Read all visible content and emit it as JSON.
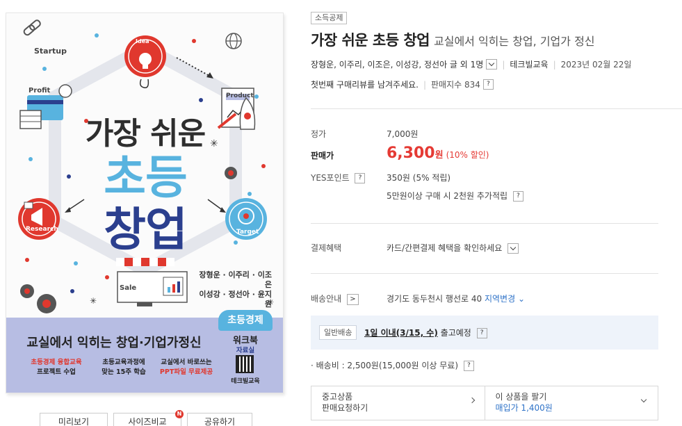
{
  "cover": {
    "label_startup": "Startup",
    "label_idea": "Idea",
    "label_product": "Product",
    "label_profit": "Profit",
    "label_research": "Research",
    "label_target": "Target",
    "label_sale": "Sale",
    "title_line1": "가장 쉬운",
    "title_line2": "초등",
    "title_line3": "창업",
    "authors_line1": "장형운 · 이주리 · 이조은",
    "authors_line2": "이성강 · 정선아 · 윤지원",
    "badge": "초등경제",
    "workbook": "워크북",
    "workbook_sub": "자료실",
    "band_title": "교실에서 익히는 창업·기업가정신",
    "features": [
      {
        "line1": "초등경제 융합교육",
        "line2": "프로젝트 수업",
        "hl_first": true
      },
      {
        "line1": "초등교육과정에",
        "line2": "맞는 15주 학습",
        "hl_first": false
      },
      {
        "line1": "교실에서 바로쓰는",
        "line2": "PPT파일 무료제공",
        "hl_first": false
      }
    ],
    "publisher": "테크빌교육",
    "colors": {
      "blue": "#58b3df",
      "navy": "#2b3f8e",
      "red": "#e0382e",
      "band": "#b7bde3"
    }
  },
  "cover_buttons": {
    "preview": "미리보기",
    "size_compare": "사이즈비교",
    "new_badge": "N",
    "share": "공유하기"
  },
  "product": {
    "category": "소득공제",
    "title": "가장 쉬운 초등 창업",
    "subtitle": "교실에서 익히는 창업, 기업가 정신",
    "authors": "장형운, 이주리, 이조은, 이성강, 정선아 글 외 1명",
    "publisher": "테크빌교육",
    "date": "2023년 02월 22일",
    "review_prompt": "첫번째 구매리뷰를 남겨주세요.",
    "sales_index": "판매지수 834",
    "help": "?"
  },
  "price": {
    "list_label": "정가",
    "list_value": "7,000원",
    "sale_label": "판매가",
    "sale_number": "6,300",
    "sale_unit": "원",
    "discount": "(10% 할인)",
    "points_label": "YES포인트",
    "points_value": "350원 (5% 적립)",
    "extra_points": "5만원이상 구매 시 2천원 추가적립"
  },
  "payment": {
    "label": "결제혜택",
    "value": "카드/간편결제 혜택을 확인하세요"
  },
  "delivery": {
    "label": "배송안내",
    "arrow": ">",
    "address": "경기도 동두천시 행선로 40",
    "change": "지역변경",
    "tag": "일반배송",
    "eta": "1일 이내(3/15, 수)",
    "eta_suffix": "출고예정",
    "fee": "· 배송비 : 2,500원(15,000원 이상 무료)"
  },
  "used": {
    "left_line1": "중고상품",
    "left_line2": "판매요청하기",
    "right_line1": "이 상품을 팔기",
    "right_line2": "매입가 1,400원"
  }
}
